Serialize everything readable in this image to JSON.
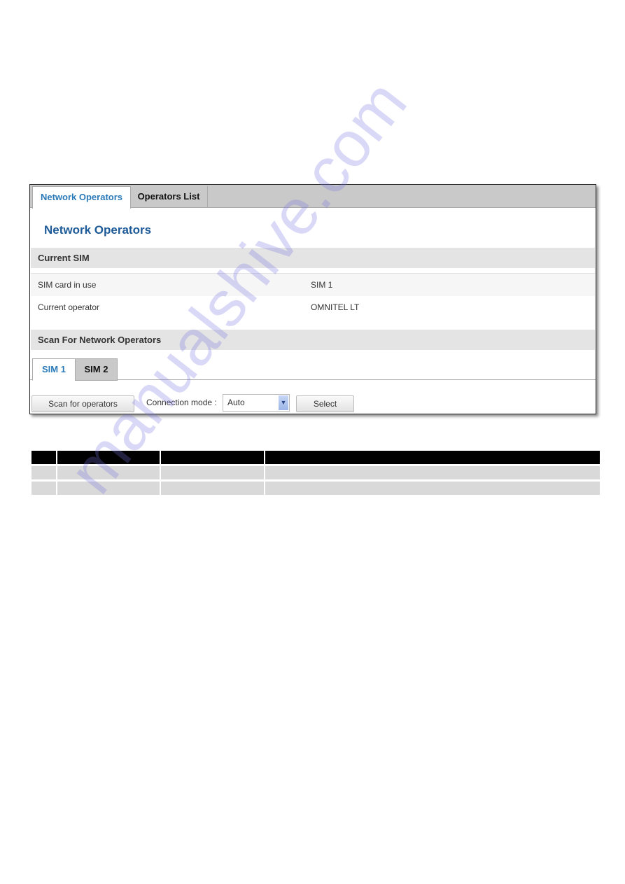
{
  "screenshot": {
    "tabs": [
      {
        "label": "Network Operators",
        "active": true
      },
      {
        "label": "Operators List",
        "active": false
      }
    ],
    "title": "Network Operators",
    "current_sim": {
      "heading": "Current SIM",
      "rows": [
        {
          "label": "SIM card in use",
          "value": "SIM 1"
        },
        {
          "label": "Current operator",
          "value": "OMNITEL LT"
        }
      ]
    },
    "scan": {
      "heading": "Scan For Network Operators",
      "sim_tabs": [
        {
          "label": "SIM 1",
          "active": true
        },
        {
          "label": "SIM 2",
          "active": false
        }
      ],
      "scan_button": "Scan for operators",
      "connection_mode_label": "Connection mode :",
      "connection_mode_value": "Auto",
      "select_button": "Select"
    }
  },
  "table": {
    "header": [
      "",
      "",
      "",
      ""
    ],
    "rows": [
      [
        "",
        "",
        "",
        ""
      ],
      [
        "",
        "",
        "",
        ""
      ]
    ]
  },
  "watermark": "manualshive.com",
  "colors": {
    "accent": "#2a7ab8",
    "title": "#1d5a97",
    "watermark": "#7878e1"
  }
}
